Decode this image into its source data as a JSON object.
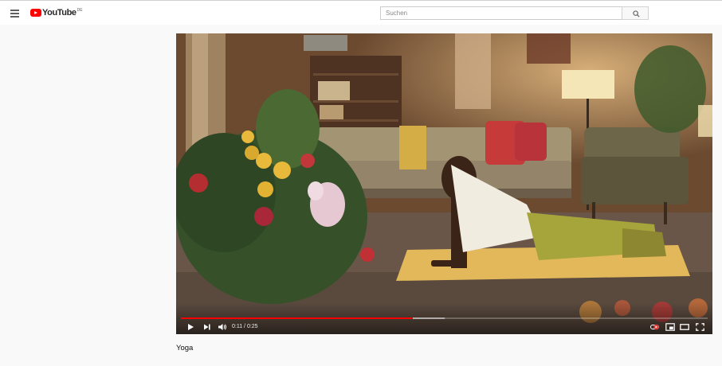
{
  "header": {
    "menu_icon": "hamburger-menu-icon",
    "logo_text": "YouTube",
    "logo_region": "DE",
    "search_placeholder": "Suchen",
    "search_icon": "magnifier-icon"
  },
  "player": {
    "current_time": "0:11",
    "duration": "0:25",
    "time_display": "0:11 / 0:25",
    "progress_played_fraction": 0.44,
    "progress_buffered_fraction": 0.5,
    "controls": [
      "play-icon",
      "next-icon",
      "volume-icon",
      "autoplay-toggle-icon",
      "miniplayer-icon",
      "theater-mode-icon",
      "fullscreen-icon"
    ]
  },
  "video": {
    "title": "Yoga"
  },
  "colors": {
    "brand_red": "#ff0000",
    "page_background": "#f9f9f9",
    "header_background": "#ffffff"
  }
}
